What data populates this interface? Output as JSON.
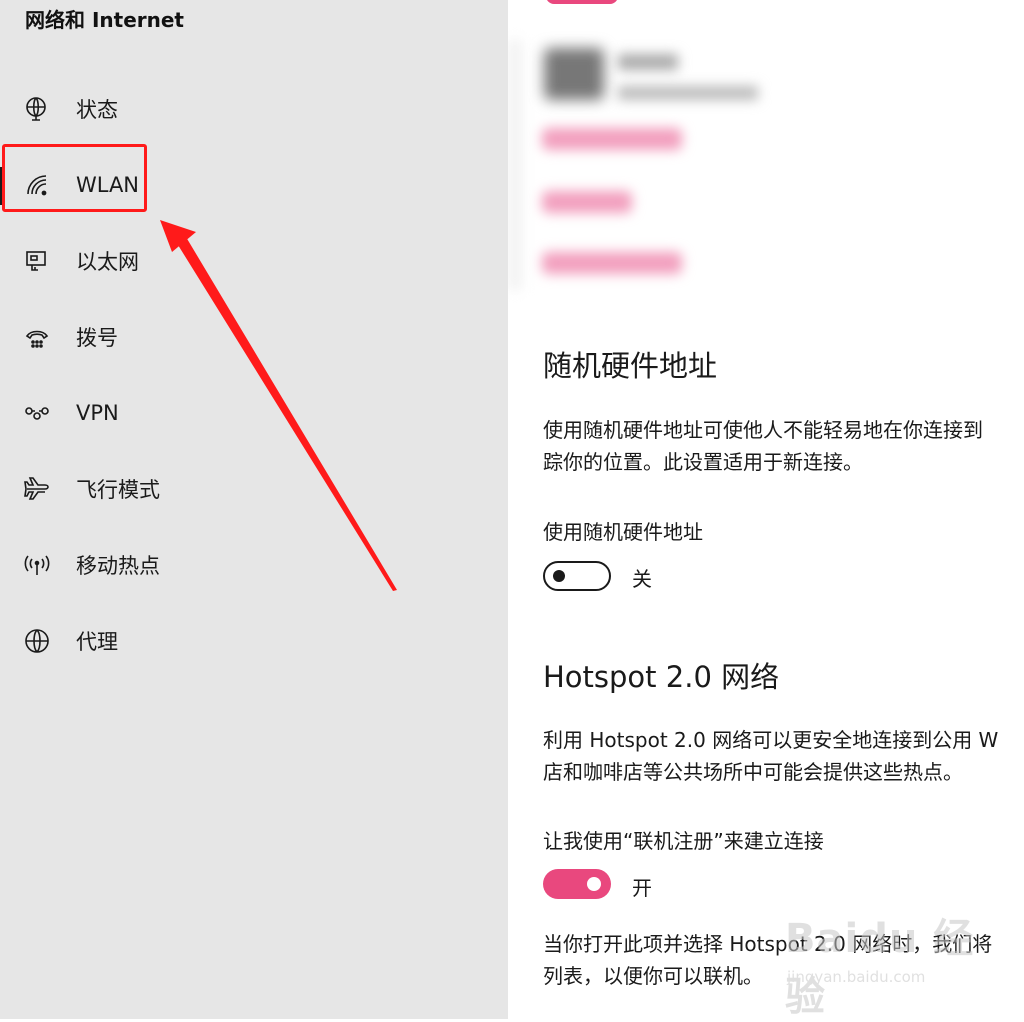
{
  "sidebar": {
    "title": "网络和 Internet",
    "items": [
      {
        "label": "状态",
        "icon": "globe-status-icon"
      },
      {
        "label": "WLAN",
        "icon": "wifi-icon"
      },
      {
        "label": "以太网",
        "icon": "ethernet-icon"
      },
      {
        "label": "拨号",
        "icon": "dialup-phone-icon"
      },
      {
        "label": "VPN",
        "icon": "vpn-icon"
      },
      {
        "label": "飞行模式",
        "icon": "airplane-icon"
      },
      {
        "label": "移动热点",
        "icon": "hotspot-icon"
      },
      {
        "label": "代理",
        "icon": "globe-proxy-icon"
      }
    ],
    "selected": "WLAN"
  },
  "annotation": {
    "box_color": "#ff1a1a",
    "arrow_color": "#ff1a1a"
  },
  "main": {
    "random_mac": {
      "heading": "随机硬件地址",
      "desc_line1": "使用随机硬件地址可使他人不能轻易地在你连接到",
      "desc_line2": "踪你的位置。此设置适用于新连接。",
      "toggle_label": "使用随机硬件地址",
      "toggle_state": "关",
      "toggle_on": false
    },
    "hotspot": {
      "heading": "Hotspot 2.0 网络",
      "desc_line1": "利用 Hotspot 2.0 网络可以更安全地连接到公用 W",
      "desc_line2": "店和咖啡店等公共场所中可能会提供这些热点。",
      "toggle_label": "让我使用“联机注册”来建立连接",
      "toggle_state": "开",
      "toggle_on": true,
      "note_line1": "当你打开此项并选择 Hotspot 2.0 网络时，我们将",
      "note_line2": "列表，以便你可以联机。"
    }
  },
  "colors": {
    "accent": "#e9487e",
    "sidebar_bg": "#e6e6e6"
  },
  "watermark": {
    "logo": "Baidu 经验",
    "url": "jingyan.baidu.com"
  }
}
